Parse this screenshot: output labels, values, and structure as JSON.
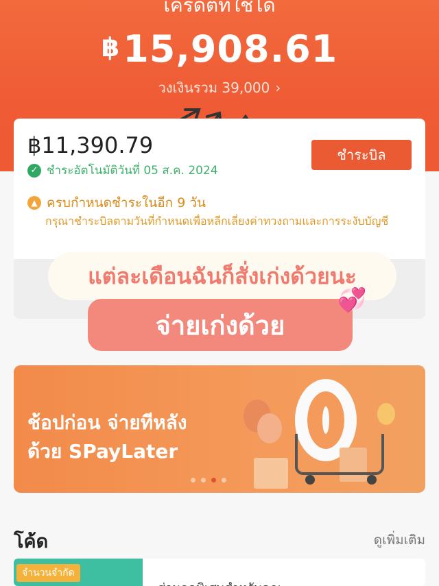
{
  "hero": {
    "title": "เครดิตที่ใช้ได้",
    "currency": "฿",
    "amount": "15,908.61",
    "limit_text": "วงเงินรวม 39,000",
    "chevron": "›"
  },
  "bill": {
    "amount": "฿11,390.79",
    "autopay_text": "ชำระอัตโนมัติวันที่ 05 ส.ค. 2024",
    "pay_button": "ชำระบิล",
    "due_title": "ครบกำหนดชำระในอีก 9 วัน",
    "due_desc": "กรุณาชำระบิลตามวันที่กำหนดเพื่อหลีกเลี่ยงค่าทวงถามและการระงับบัญชี"
  },
  "stickers": {
    "line1": "แต่ละเดือนฉันก็สั่งเก่งด้วยนะ",
    "line2": "จ่ายเก่งด้วย",
    "heart": "💞"
  },
  "banner": {
    "line1": "ช้อปก่อน จ่ายทีหลัง",
    "line2": "ด้วย SPayLater",
    "zero": "0",
    "active_slide": 3,
    "slide_count": 4
  },
  "codes": {
    "title": "โค้ด",
    "see_more": "ดูเพิ่มเติม",
    "badge": "จำนวนจำกัด",
    "text": "ส่วนลดพิเศษสำหรับคุณ"
  }
}
